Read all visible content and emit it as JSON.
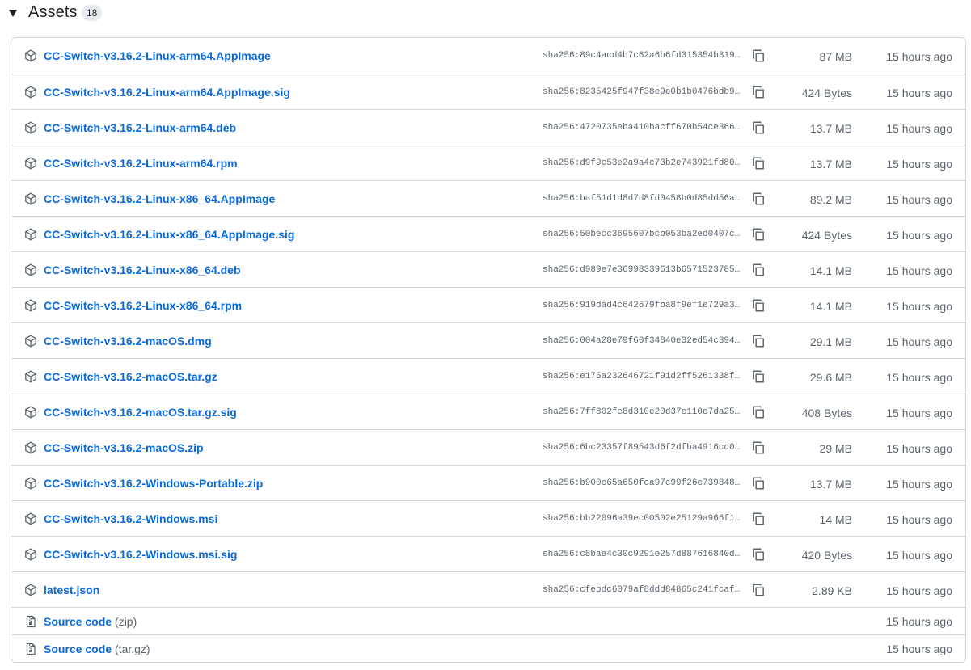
{
  "header": {
    "title": "Assets",
    "count": "18"
  },
  "assets": [
    {
      "name": "CC-Switch-v3.16.2-Linux-arm64.AppImage",
      "sha": "sha256:89c4acd4b7c62a6b6fd315354b319…",
      "size": "87 MB",
      "time": "15 hours ago"
    },
    {
      "name": "CC-Switch-v3.16.2-Linux-arm64.AppImage.sig",
      "sha": "sha256:8235425f947f38e9e0b1b0476bdb9…",
      "size": "424 Bytes",
      "time": "15 hours ago"
    },
    {
      "name": "CC-Switch-v3.16.2-Linux-arm64.deb",
      "sha": "sha256:4720735eba410bacff670b54ce366…",
      "size": "13.7 MB",
      "time": "15 hours ago"
    },
    {
      "name": "CC-Switch-v3.16.2-Linux-arm64.rpm",
      "sha": "sha256:d9f9c53e2a9a4c73b2e743921fd80…",
      "size": "13.7 MB",
      "time": "15 hours ago"
    },
    {
      "name": "CC-Switch-v3.16.2-Linux-x86_64.AppImage",
      "sha": "sha256:baf51d1d8d7d8fd0458b0d85dd56a…",
      "size": "89.2 MB",
      "time": "15 hours ago"
    },
    {
      "name": "CC-Switch-v3.16.2-Linux-x86_64.AppImage.sig",
      "sha": "sha256:50becc3695607bcb053ba2ed0407c…",
      "size": "424 Bytes",
      "time": "15 hours ago"
    },
    {
      "name": "CC-Switch-v3.16.2-Linux-x86_64.deb",
      "sha": "sha256:d989e7e36998339613b6571523785…",
      "size": "14.1 MB",
      "time": "15 hours ago"
    },
    {
      "name": "CC-Switch-v3.16.2-Linux-x86_64.rpm",
      "sha": "sha256:919dad4c642679fba8f9ef1e729a3…",
      "size": "14.1 MB",
      "time": "15 hours ago"
    },
    {
      "name": "CC-Switch-v3.16.2-macOS.dmg",
      "sha": "sha256:004a28e79f60f34840e32ed54c394…",
      "size": "29.1 MB",
      "time": "15 hours ago"
    },
    {
      "name": "CC-Switch-v3.16.2-macOS.tar.gz",
      "sha": "sha256:e175a232646721f91d2ff5261338f…",
      "size": "29.6 MB",
      "time": "15 hours ago"
    },
    {
      "name": "CC-Switch-v3.16.2-macOS.tar.gz.sig",
      "sha": "sha256:7ff802fc8d310e20d37c110c7da25…",
      "size": "408 Bytes",
      "time": "15 hours ago"
    },
    {
      "name": "CC-Switch-v3.16.2-macOS.zip",
      "sha": "sha256:6bc23357f89543d6f2dfba4916cd0…",
      "size": "29 MB",
      "time": "15 hours ago"
    },
    {
      "name": "CC-Switch-v3.16.2-Windows-Portable.zip",
      "sha": "sha256:b900c65a650fca97c99f26c739848…",
      "size": "13.7 MB",
      "time": "15 hours ago"
    },
    {
      "name": "CC-Switch-v3.16.2-Windows.msi",
      "sha": "sha256:bb22096a39ec00502e25129a966f1…",
      "size": "14 MB",
      "time": "15 hours ago"
    },
    {
      "name": "CC-Switch-v3.16.2-Windows.msi.sig",
      "sha": "sha256:c8bae4c30c9291e257d887616840d…",
      "size": "420 Bytes",
      "time": "15 hours ago"
    },
    {
      "name": "latest.json",
      "sha": "sha256:cfebdc6079af8ddd84865c241fcaf…",
      "size": "2.89 KB",
      "time": "15 hours ago"
    }
  ],
  "sources": [
    {
      "label": "Source code",
      "suffix": "(zip)",
      "time": "15 hours ago"
    },
    {
      "label": "Source code",
      "suffix": "(tar.gz)",
      "time": "15 hours ago"
    }
  ],
  "icons": {
    "caret": "triangle-down-icon",
    "asset": "package-icon",
    "copy": "copy-icon",
    "source": "file-zip-icon"
  },
  "colors": {
    "link": "#0969da",
    "muted": "#59636e",
    "border": "#d1d9e0",
    "counter_bg": "#e6e9ed"
  }
}
